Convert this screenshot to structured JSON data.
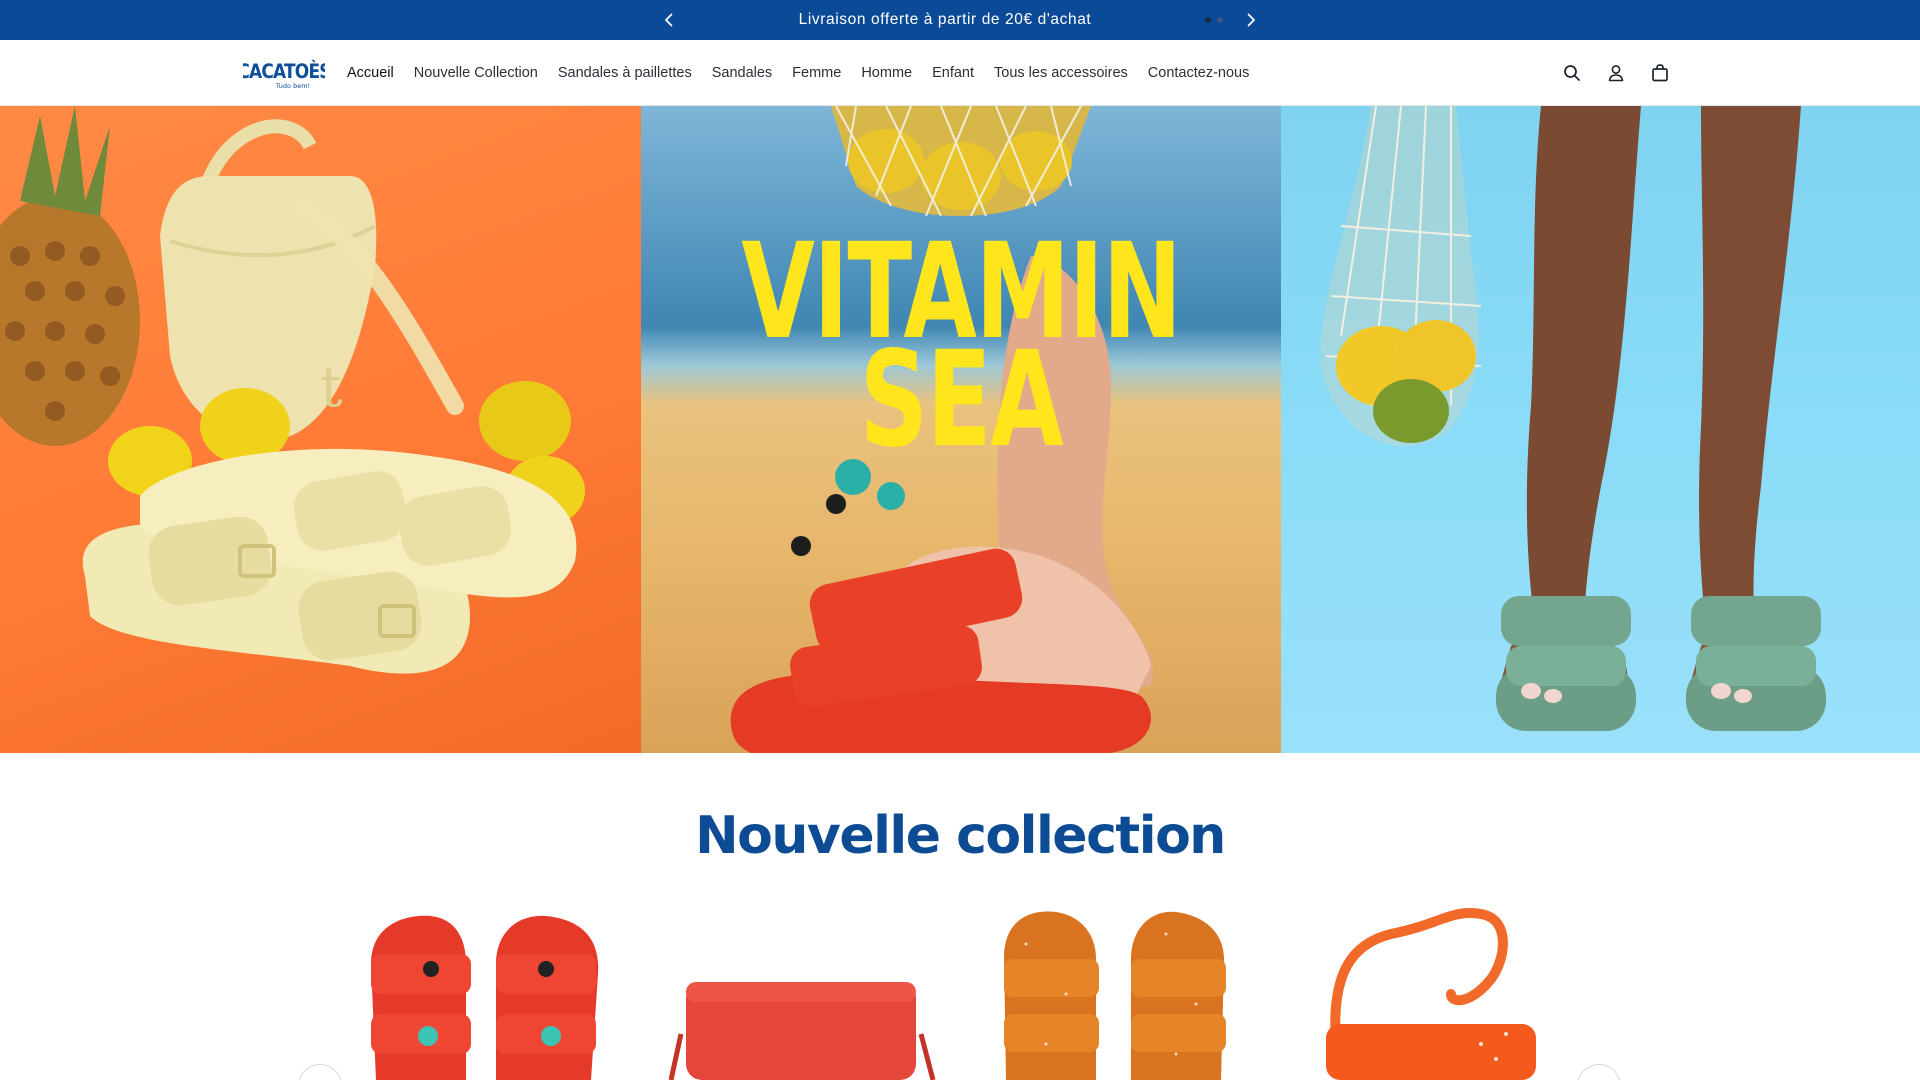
{
  "announcement": {
    "message": "Livraison offerte à partir de 20€ d'achat",
    "prev_icon": "chevron-left-icon",
    "next_icon": "chevron-right-icon",
    "slides": 2,
    "active_slide": 1
  },
  "header": {
    "logo_text": "CACATOÈS",
    "logo_tagline": "Tudo bem!",
    "nav": [
      {
        "label": "Accueil"
      },
      {
        "label": "Nouvelle Collection"
      },
      {
        "label": "Sandales à paillettes"
      },
      {
        "label": "Sandales"
      },
      {
        "label": "Femme"
      },
      {
        "label": "Homme"
      },
      {
        "label": "Enfant"
      },
      {
        "label": "Tous les accessoires"
      },
      {
        "label": "Contactez-nous"
      }
    ],
    "icons": [
      "search-icon",
      "account-icon",
      "cart-icon"
    ]
  },
  "hero": {
    "headline_line1": "VITAMIN",
    "headline_line2": "SEA"
  },
  "section": {
    "title": "Nouvelle collection"
  },
  "colors": {
    "brand_blue": "#0b4a96",
    "title_blue": "#0d4c94",
    "headline_yellow": "#ffe61c"
  }
}
